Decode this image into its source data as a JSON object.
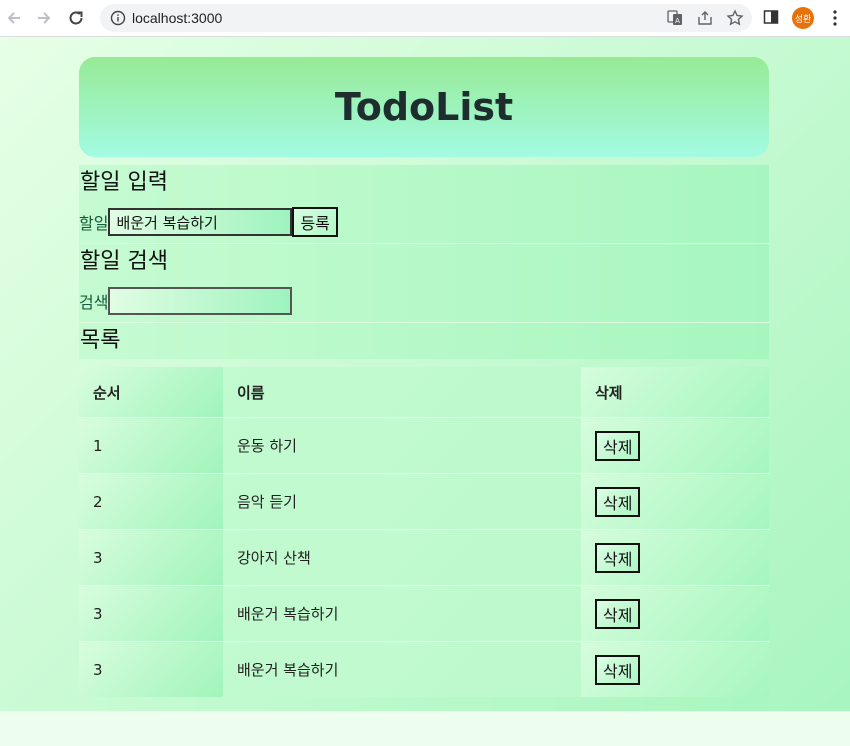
{
  "browser": {
    "url": "localhost:3000",
    "avatar_text": "성환"
  },
  "app": {
    "title": "TodoList"
  },
  "input_section": {
    "title": "할일 입력",
    "label": "할일",
    "value": "배운거 복습하기",
    "button": "등록"
  },
  "search_section": {
    "title": "할일 검색",
    "label": "검색",
    "value": ""
  },
  "list_section": {
    "title": "목록",
    "headers": [
      "순서",
      "이름",
      "삭제"
    ],
    "rows": [
      {
        "order": "1",
        "name": "운동 하기",
        "action": "삭제"
      },
      {
        "order": "2",
        "name": "음악 듣기",
        "action": "삭제"
      },
      {
        "order": "3",
        "name": "강아지 산책",
        "action": "삭제"
      },
      {
        "order": "3",
        "name": "배운거 복습하기",
        "action": "삭제"
      },
      {
        "order": "3",
        "name": "배운거 복습하기",
        "action": "삭제"
      }
    ]
  }
}
